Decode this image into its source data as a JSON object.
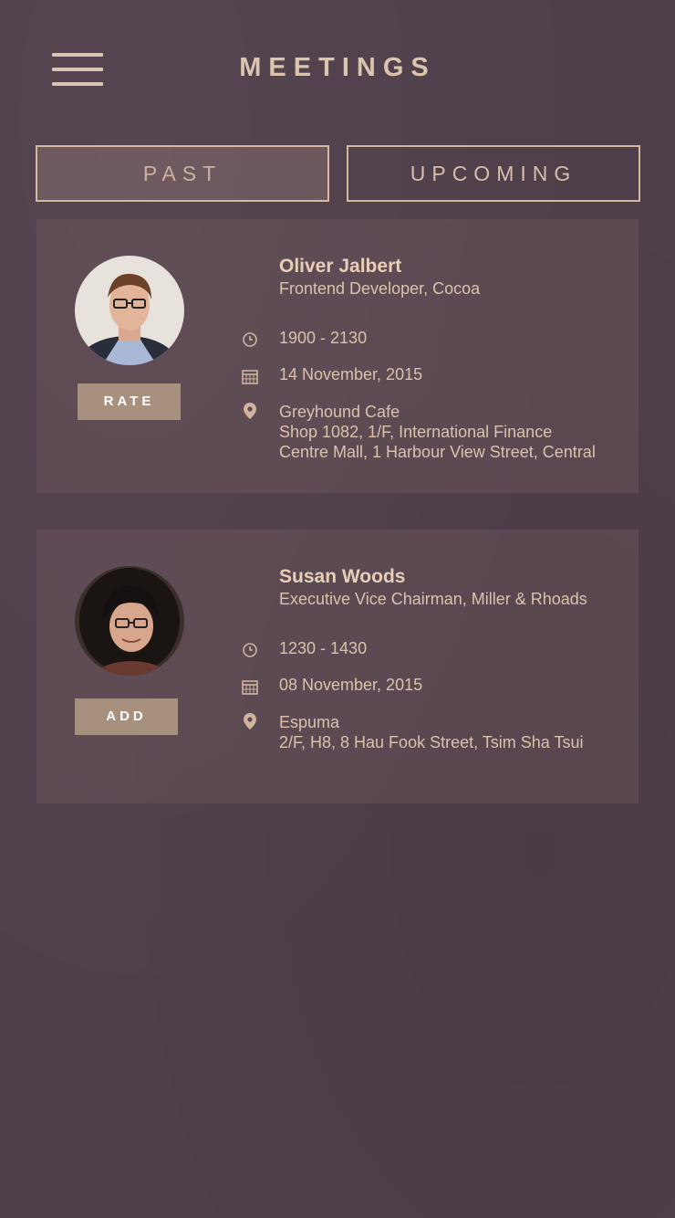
{
  "header": {
    "title": "MEETINGS",
    "menu_icon": "hamburger-menu-icon"
  },
  "tabs": [
    {
      "label": "PAST",
      "active": true
    },
    {
      "label": "UPCOMING",
      "active": false
    }
  ],
  "meetings": [
    {
      "name": "Oliver Jalbert",
      "role": "Frontend Developer, Cocoa",
      "time": "1900 - 2130",
      "date": "14 November, 2015",
      "venue": "Greyhound Cafe",
      "address_line1": "Shop 1082, 1/F, International Finance",
      "address_line2": "Centre Mall, 1 Harbour View Street, Central",
      "action_label": "RATE"
    },
    {
      "name": "Susan Woods",
      "role": "Executive Vice Chairman, Miller & Rhoads",
      "time": "1230 - 1430",
      "date": "08 November, 2015",
      "venue": "Espuma",
      "address_line1": "2/F, H8, 8 Hau Fook Street, Tsim Sha Tsui",
      "address_line2": "",
      "action_label": "ADD"
    }
  ],
  "colors": {
    "background": "#4f3f4b",
    "accent": "#dcc5ae",
    "button": "#a8907f"
  }
}
